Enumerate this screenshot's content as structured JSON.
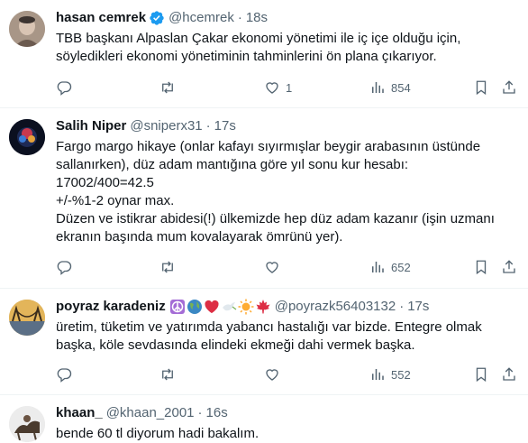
{
  "tweets": [
    {
      "name": "hasan cemrek",
      "handle": "@hcemrek",
      "dot": "·",
      "time": "18s",
      "verified": true,
      "text": "TBB başkanı Alpaslan Çakar ekonomi yönetimi ile iç içe olduğu için,\nsöyledikleri ekonomi yönetiminin tahminlerini ön plana çıkarıyor.",
      "likes": "1",
      "views": "854"
    },
    {
      "name": "Salih Niper",
      "handle": "@sniperx31",
      "dot": "·",
      "time": "17s",
      "verified": false,
      "text": "Fargo margo hikaye (onlar kafayı sıyırmışlar beygir arabasının üstünde\nsallanırken), düz adam mantığına göre yıl sonu kur hesabı:\n17002/400=42.5\n+/-%1-2 oynar max.\nDüzen ve istikrar abidesi(!) ülkemizde hep düz adam kazanır (işin uzmanı\nekranın başında mum kovalayarak ömrünü yer).",
      "likes": "",
      "views": "652"
    },
    {
      "name": "poyraz karadeniz",
      "handle": "@poyrazk56403132",
      "dot": "·",
      "time": "17s",
      "verified": false,
      "emojis": [
        "peace-symbol",
        "globe",
        "red-heart",
        "dove",
        "sun",
        "maple-leaf"
      ],
      "text": "üretim, tüketim ve yatırımda yabancı hastalığı var bizde. Entegre olmak\nbaşka, köle sevdasında elindeki ekmeği dahi vermek başka.",
      "likes": "",
      "views": "552"
    },
    {
      "name": "khaan_",
      "handle": "@khaan_2001",
      "dot": "·",
      "time": "16s",
      "verified": false,
      "text": "bende 60 tl diyorum hadi bakalım."
    }
  ],
  "colors": {
    "text": "#0f1419",
    "muted": "#536471",
    "accent": "#1d9bf0",
    "border": "#eff3f4"
  }
}
